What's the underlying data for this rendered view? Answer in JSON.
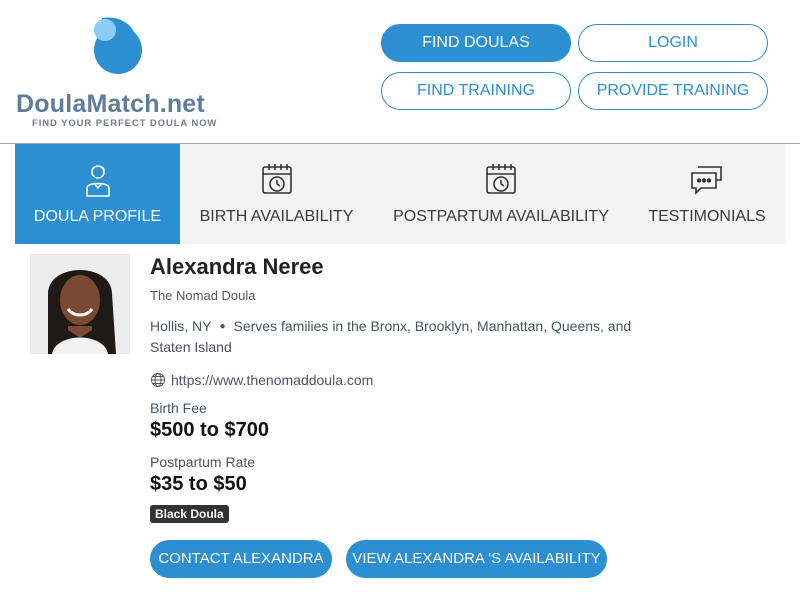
{
  "brand": {
    "name_main": "DoulaMatch",
    "name_suffix": ".net",
    "tagline": "FIND YOUR PERFECT DOULA NOW",
    "primary_color": "#2b8fd1",
    "logo_icon": "drop-logo-icon"
  },
  "nav": {
    "find_doulas": "FIND DOULAS",
    "login": "LOGIN",
    "find_training": "FIND TRAINING",
    "provide_training": "PROVIDE TRAINING"
  },
  "tabs": [
    {
      "label": "DOULA PROFILE",
      "icon": "person-icon",
      "active": true
    },
    {
      "label": "BIRTH AVAILABILITY",
      "icon": "calendar-clock-icon",
      "active": false
    },
    {
      "label": "POSTPARTUM AVAILABILITY",
      "icon": "calendar-clock-icon",
      "active": false
    },
    {
      "label": "TESTIMONIALS",
      "icon": "chat-bubbles-icon",
      "active": false
    }
  ],
  "profile": {
    "name": "Alexandra Neree",
    "business": "The Nomad Doula",
    "location": "Hollis, NY",
    "service_area": "Serves families in the Bronx, Brooklyn, Manhattan, Queens, and Staten Island",
    "website": "https://www.thenomaddoula.com",
    "birth_fee_label": "Birth Fee",
    "birth_fee": "$500 to $700",
    "postpartum_label": "Postpartum Rate",
    "postpartum_rate": "$35 to $50",
    "badge": "Black Doula",
    "contact_button": "CONTACT ALEXANDRA",
    "availability_button": "VIEW ALEXANDRA 'S AVAILABILITY"
  }
}
